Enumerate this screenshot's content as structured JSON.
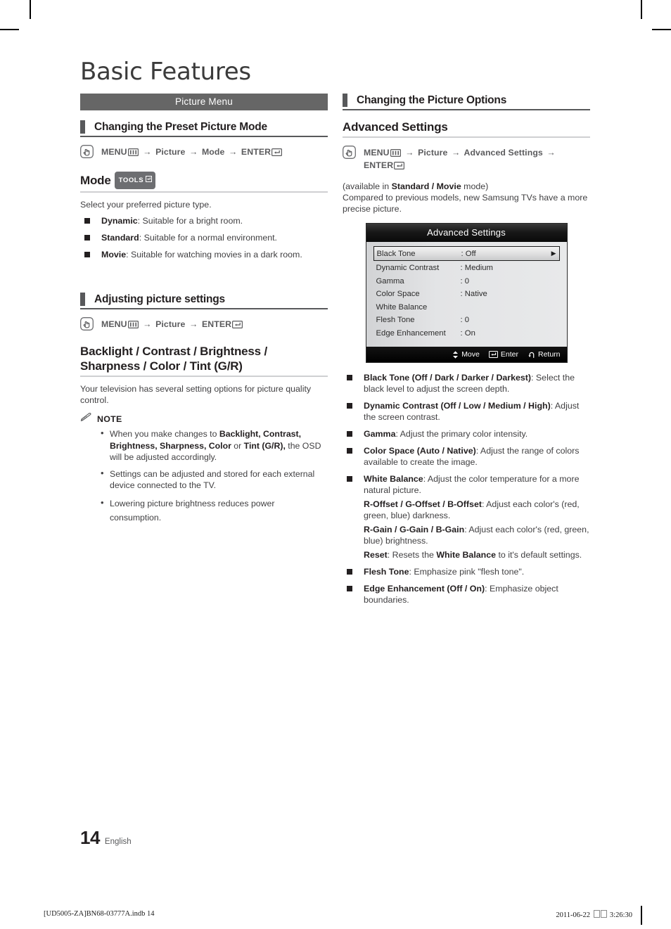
{
  "document": {
    "title": "Basic Features",
    "page_number": "14",
    "language": "English",
    "footer_left": "[UD5005-ZA]BN68-03777A.indb   14",
    "footer_date": "2011-06-22",
    "footer_time": "3:26:30"
  },
  "left_column": {
    "band_label": "Picture Menu",
    "section1": {
      "heading": "Changing the Preset Picture Mode",
      "path": {
        "menu": "MENU",
        "steps": [
          "Picture",
          "Mode"
        ],
        "enter": "ENTER"
      },
      "h3": "Mode",
      "tools_badge": "TOOLS",
      "intro": "Select your preferred picture type.",
      "bullets": [
        {
          "term": "Dynamic",
          "desc": ": Suitable for a bright room."
        },
        {
          "term": "Standard",
          "desc": ": Suitable for a normal environment."
        },
        {
          "term": "Movie",
          "desc": ": Suitable for watching movies in a dark room."
        }
      ]
    },
    "section2": {
      "heading": "Adjusting picture settings",
      "path": {
        "menu": "MENU",
        "steps": [
          "Picture"
        ],
        "enter": "ENTER"
      },
      "h3": "Backlight / Contrast / Brightness / Sharpness / Color / Tint (G/R)",
      "intro": "Your television has several setting options for picture quality control.",
      "note_label": "NOTE",
      "notes": [
        "When you make changes to <b>Backlight, Contrast, Brightness, Sharpness, Color</b> or <b>Tint (G/R),</b> the OSD will be adjusted accordingly.",
        "Settings can be adjusted and stored for each external device connected to the TV.",
        "Lowering picture brightness reduces power consumption."
      ]
    }
  },
  "right_column": {
    "heading": "Changing the Picture Options",
    "h3": "Advanced Settings",
    "path": {
      "menu": "MENU",
      "steps": [
        "Picture",
        "Advanced Settings"
      ],
      "enter": "ENTER"
    },
    "availability": "(available in <b>Standard / Movie</b> mode)",
    "intro": "Compared to previous models, new Samsung TVs have a more precise picture.",
    "osd": {
      "title": "Advanced Settings",
      "rows": [
        {
          "name": "Black Tone",
          "value": ": Off",
          "selected": true,
          "arrow": "▶"
        },
        {
          "name": "Dynamic Contrast",
          "value": ": Medium",
          "selected": false,
          "arrow": ""
        },
        {
          "name": "Gamma",
          "value": ": 0",
          "selected": false,
          "arrow": ""
        },
        {
          "name": "Color Space",
          "value": ": Native",
          "selected": false,
          "arrow": ""
        },
        {
          "name": "White Balance",
          "value": "",
          "selected": false,
          "arrow": ""
        },
        {
          "name": "Flesh Tone",
          "value": ": 0",
          "selected": false,
          "arrow": ""
        },
        {
          "name": "Edge Enhancement",
          "value": ": On",
          "selected": false,
          "arrow": ""
        }
      ],
      "footer": [
        {
          "icon": "up-down-arrow-icon",
          "label": "Move"
        },
        {
          "icon": "enter-key-icon",
          "label": "Enter"
        },
        {
          "icon": "return-arrow-icon",
          "label": "Return"
        }
      ]
    },
    "bullets": [
      {
        "term": "Black Tone (Off / Dark / Darker / Darkest)",
        "desc": ": Select the black level to adjust the screen depth."
      },
      {
        "term": "Dynamic Contrast (Off / Low / Medium / High)",
        "desc": ": Adjust the screen contrast."
      },
      {
        "term": "Gamma",
        "desc": ": Adjust the primary color intensity."
      },
      {
        "term": "Color Space (Auto / Native)",
        "desc": ": Adjust the range of colors available to create the image."
      },
      {
        "term": "White Balance",
        "desc": ": Adjust the color temperature for a more natural picture."
      },
      {
        "term": "Flesh Tone",
        "desc": ": Emphasize pink \"flesh tone\"."
      },
      {
        "term": "Edge Enhancement (Off / On)",
        "desc": ": Emphasize object boundaries."
      }
    ],
    "sub_items": [
      "<b>R-Offset / G-Offset / B-Offset</b>: Adjust each color's (red, green, blue) darkness.",
      "<b>R-Gain / G-Gain / B-Gain</b>: Adjust each color's (red, green, blue) brightness.",
      "<b>Reset</b>: Resets the <b>White Balance</b> to it's default settings."
    ]
  },
  "colors": {
    "band": "#666666",
    "heading_tab": "#58595b",
    "rule": "#cfd0d2",
    "body_text": "#414042",
    "osd_title_bg": "#181818"
  }
}
